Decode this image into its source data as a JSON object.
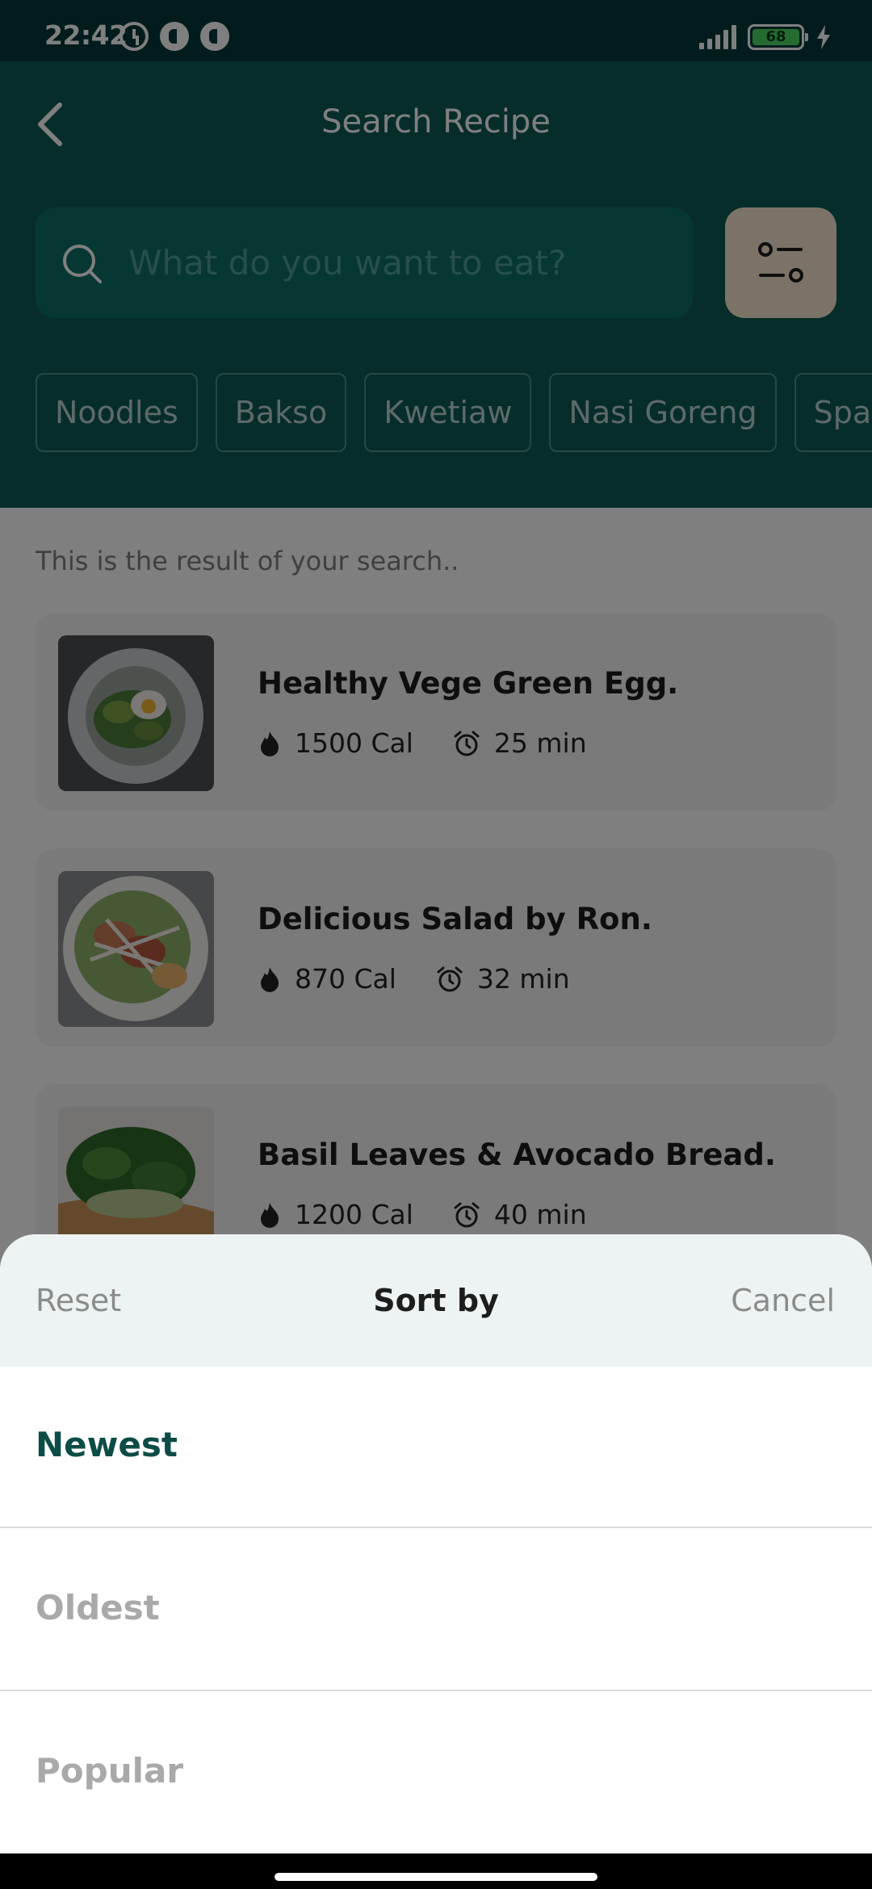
{
  "status_bar": {
    "time": "22:42",
    "battery": "68"
  },
  "header": {
    "title": "Search Recipe"
  },
  "search": {
    "placeholder": "What do you want to eat?"
  },
  "chips": [
    {
      "label": "Noodles"
    },
    {
      "label": "Bakso"
    },
    {
      "label": "Kwetiaw"
    },
    {
      "label": "Nasi Goreng"
    },
    {
      "label": "Spaghetti"
    }
  ],
  "results": {
    "hint": "This is the result of your search..",
    "items": [
      {
        "title": "Healthy Vege Green Egg.",
        "calories": "1500 Cal",
        "time": "25 min"
      },
      {
        "title": "Delicious Salad by Ron.",
        "calories": "870 Cal",
        "time": "32 min"
      },
      {
        "title": "Basil Leaves & Avocado Bread.",
        "calories": "1200 Cal",
        "time": "40 min"
      }
    ]
  },
  "sort_sheet": {
    "reset_label": "Reset",
    "title": "Sort by",
    "cancel_label": "Cancel",
    "options": [
      {
        "label": "Newest",
        "selected": true
      },
      {
        "label": "Oldest",
        "selected": false
      },
      {
        "label": "Popular",
        "selected": false
      }
    ]
  },
  "colors": {
    "brand_dark": "#0c5a54",
    "accent_selected": "#0b4c46",
    "filter_button": "#f6e7cf"
  }
}
